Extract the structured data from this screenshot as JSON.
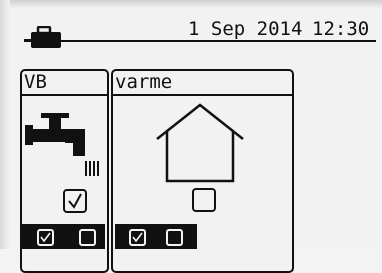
{
  "status": {
    "date": "1 Sep 2014",
    "time": "12:30"
  },
  "panels": [
    {
      "title": "VB",
      "checked": true,
      "footer": [
        true,
        false
      ]
    },
    {
      "title": "varme",
      "checked": false,
      "footer": [
        true,
        false
      ]
    }
  ],
  "icons": {
    "status": "briefcase-icon",
    "vb": "tap-icon",
    "varme": "house-icon"
  }
}
